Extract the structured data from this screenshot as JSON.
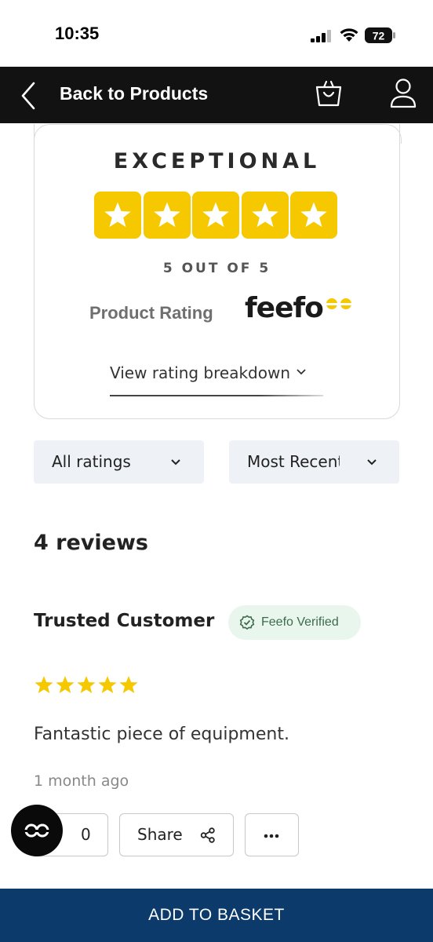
{
  "status_bar": {
    "time": "10:35",
    "battery_level": "72"
  },
  "nav": {
    "title": "Back to Products",
    "icons": [
      "chevron-left-icon",
      "shopping-bag-icon",
      "user-icon"
    ]
  },
  "rating_card": {
    "heading": "EXCEPTIONAL",
    "stars": 5,
    "score_text": "5 OUT OF 5",
    "product_rating_label": "Product Rating",
    "brand": "feefo",
    "breakdown_link": "View rating breakdown"
  },
  "filters": {
    "ratings": {
      "selected": "All ratings"
    },
    "sort": {
      "selected": "Most Recent"
    }
  },
  "reviews_count_text": "4 reviews",
  "review": {
    "author": "Trusted Customer",
    "badge": "Feefo Verified",
    "stars": 5,
    "text": "Fantastic piece of equipment.",
    "date": "1 month ago",
    "helpful_count": "0",
    "share_label": "Share"
  },
  "cta": {
    "add_to_basket": "ADD TO BASKET"
  },
  "colors": {
    "nav_bg": "#121212",
    "star_yellow": "#f5c800",
    "filter_bg": "#eef1f5",
    "badge_bg": "#e9f6ee",
    "cta_bg": "#0b3a6b"
  }
}
